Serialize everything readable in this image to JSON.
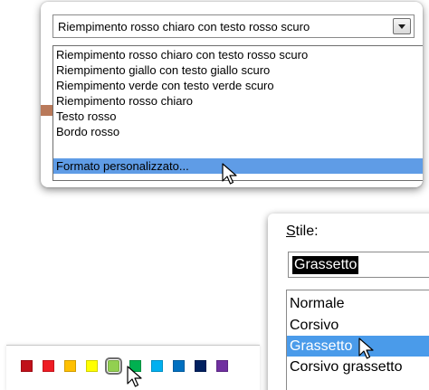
{
  "conditional_format": {
    "combo_value": "Riempimento rosso chiaro con testo rosso scuro",
    "options": [
      "Riempimento rosso chiaro con testo rosso scuro",
      "Riempimento giallo con testo giallo scuro",
      "Riempimento verde con testo verde scuro",
      "Riempimento rosso chiaro",
      "Testo rosso",
      "Bordo rosso",
      "Formato personalizzato..."
    ],
    "selected_index": 6
  },
  "font_style": {
    "label": "Stile:",
    "label_access_key": "S",
    "label_rest": "tile:",
    "input_value": "Grassetto",
    "options": [
      "Normale",
      "Corsivo",
      "Grassetto",
      "Corsivo grassetto"
    ],
    "selected_index": 2
  },
  "palette": {
    "colors": [
      "#c0111a",
      "#ee1c24",
      "#ffc000",
      "#ffff00",
      "#92d050",
      "#00b050",
      "#00b0f0",
      "#0070c0",
      "#002060",
      "#7030a0"
    ],
    "highlighted_index": 4
  },
  "icons": {
    "cursor": "arrow-cursor-icon",
    "dropdown": "dropdown-arrow-icon"
  }
}
